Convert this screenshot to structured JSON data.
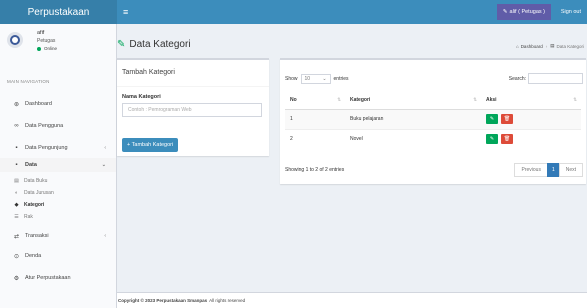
{
  "app": {
    "logo": "Perpustakaan"
  },
  "header": {
    "toggle": "≡",
    "user_chip": "alif ( Petugas )",
    "signout": "Sign out"
  },
  "user": {
    "name": "afif",
    "role": "Petugas",
    "status": "Online"
  },
  "sidebar": {
    "nav_header": "MAIN NAVIGATION",
    "items": [
      {
        "label": "Dashboard",
        "icon": "dashboard-icon",
        "glyph": "⊛"
      },
      {
        "label": "Data Pengguna",
        "icon": "users-icon",
        "glyph": "👥"
      },
      {
        "label": "Data Pengunjung",
        "icon": "book-icon",
        "glyph": "▪",
        "chevron": "‹"
      },
      {
        "label": "Data",
        "icon": "book-icon",
        "glyph": "▪",
        "chevron": "⌄"
      },
      {
        "label": "Transaksi",
        "icon": "exchange-icon",
        "glyph": "⇄",
        "chevron": "‹"
      },
      {
        "label": "Denda",
        "icon": "money-icon",
        "glyph": "⊙"
      },
      {
        "label": "Atur Perpustakaan",
        "icon": "cogs-icon",
        "glyph": "⚙"
      }
    ],
    "sub_items": [
      {
        "label": "Data Buku",
        "icon": "book-icon",
        "glyph": "▤"
      },
      {
        "label": "Data Jurusan",
        "icon": "globe-icon",
        "glyph": "◐"
      },
      {
        "label": "Kategori",
        "icon": "tag-icon",
        "glyph": "◆"
      },
      {
        "label": "Rak",
        "icon": "bars-icon",
        "glyph": "☰"
      }
    ]
  },
  "page": {
    "title": "Data Kategori",
    "title_icon": "✎",
    "breadcrumb": {
      "home": "Dashboard",
      "sep": "›",
      "current": "Data Kategori",
      "home_icon": "⌂",
      "current_icon": "▤"
    }
  },
  "form": {
    "title": "Tambah Kategori",
    "label": "Nama Kategori",
    "placeholder": "Contoh : Pemrograman Web",
    "button": "+ Tambah Kategori"
  },
  "table": {
    "show_prefix": "Show",
    "show_value": "10",
    "show_suffix": "entries",
    "search_label": "Search:",
    "columns": [
      "No",
      "Kategori",
      "Aksi"
    ],
    "rows": [
      {
        "no": "1",
        "kategori": "Buku pelajaran"
      },
      {
        "no": "2",
        "kategori": "Novel"
      }
    ],
    "info": "Showing 1 to 2 of 2 entries",
    "pager": {
      "previous": "Previous",
      "current": "1",
      "next": "Next"
    }
  },
  "footer": {
    "bold": "Copyright © 2023 Perpustakaan Smanpas",
    "rest": "All rights reserved"
  },
  "colors": {
    "header": "#3c8dbc",
    "logo": "#367fa9",
    "user_chip": "#605ca8",
    "edit": "#00a65a",
    "delete": "#dd4b39"
  }
}
